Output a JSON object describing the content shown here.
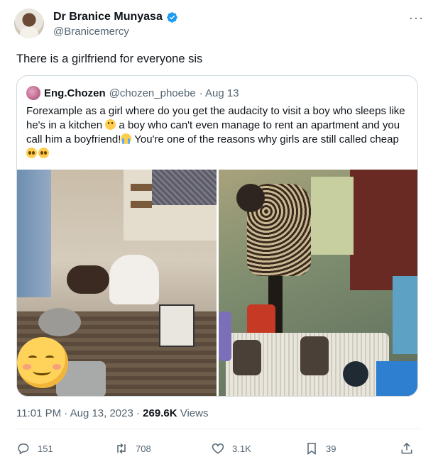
{
  "author": {
    "display_name": "Dr Branice Munyasa",
    "handle": "@Branicemercy"
  },
  "tweet": {
    "text": "There is a girlfriend for everyone sis"
  },
  "quote": {
    "display_name": "Eng.Chozen",
    "handle": "@chozen_phoebe",
    "date": "· Aug 13",
    "text_part1": "Forexample as a girl where do you get the audacity to visit a boy who sleeps like he's in a kitchen ",
    "text_part2": " a boy who can't even manage to rent an apartment and you call him a boyfriend!",
    "text_part3": " You're one of the reasons why girls are still called cheap ",
    "icons": [
      "thinking-emoji",
      "crying-emoji",
      "pleading-emoji"
    ]
  },
  "meta": {
    "time_date": "11:01 PM · Aug 13, 2023 · ",
    "views_count": "269.6K",
    "views_label": " Views"
  },
  "actions": {
    "replies": "151",
    "retweets": "708",
    "likes": "3.1K",
    "bookmarks": "39"
  },
  "colors": {
    "verified": "#1d9bf0",
    "secondary_text": "#536471",
    "border": "#cfd9de"
  }
}
